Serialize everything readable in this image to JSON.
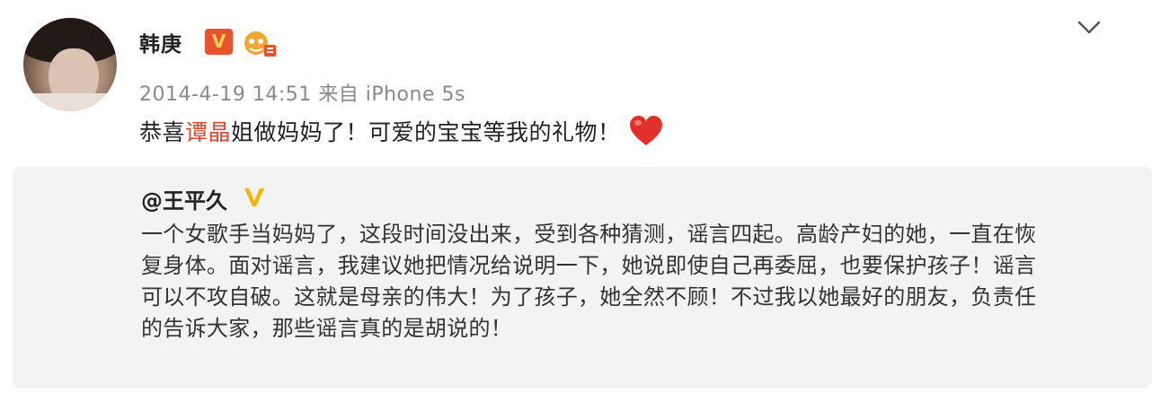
{
  "post": {
    "username": "韩庚",
    "verified_mark": "V",
    "meta": "2014-4-19 14:51 来自 iPhone 5s",
    "content_before": "恭喜",
    "content_mention": "谭晶",
    "content_after": "姐做妈妈了！可爱的宝宝等我的礼物！",
    "heart_icon": "heart-icon",
    "expand_icon": "chevron-down-icon"
  },
  "quote": {
    "author": "@王平久",
    "lines": [
      "一个女歌手当妈妈了，这段时间没出来，受到各种猜测，谣言四起。高龄产妇的她，一直在恢",
      "复身体。面对谣言，我建议她把情况给说明一下，她说即使自己再委屈，也要保护孩子！谣言",
      "可以不攻自破。这就是母亲的伟大！为了孩子，她全然不顾！不过我以她最好的朋友，负责任",
      "的告诉大家，那些谣言真的是胡说的！"
    ]
  },
  "colors": {
    "mention": "#d94a2c",
    "verified_red": "#e8522e",
    "verified_gold": "#f5b400",
    "meta_gray": "#8a8a8a",
    "quote_bg": "#f3f3f3",
    "heart": "#e0302a"
  }
}
